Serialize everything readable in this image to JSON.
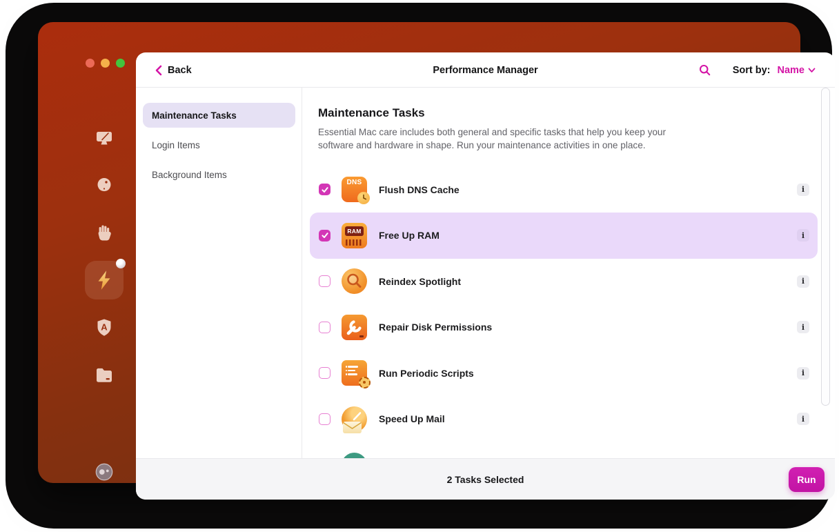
{
  "header": {
    "back_label": "Back",
    "title": "Performance Manager",
    "sort_by_label": "Sort by:",
    "sort_value": "Name"
  },
  "window": {
    "controls": [
      "close",
      "minimize",
      "zoom"
    ],
    "sidebar_icons": [
      "cleanup-icon",
      "ball-icon",
      "hand-icon",
      "lightning-icon",
      "applications-shield-icon",
      "folder-icon",
      "assistant-icon"
    ],
    "active_sidebar_icon": "lightning-icon",
    "active_has_notification_dot": true
  },
  "nav": {
    "items": [
      {
        "label": "Maintenance Tasks",
        "selected": true
      },
      {
        "label": "Login Items",
        "selected": false
      },
      {
        "label": "Background Items",
        "selected": false
      }
    ]
  },
  "content": {
    "heading": "Maintenance Tasks",
    "description": "Essential Mac care includes both general and specific tasks that help you keep your software and hardware in shape. Run your maintenance activities in one place.",
    "tasks": [
      {
        "label": "Flush DNS Cache",
        "checked": true,
        "highlighted": false,
        "icon": "dns-cache-icon"
      },
      {
        "label": "Free Up RAM",
        "checked": true,
        "highlighted": true,
        "icon": "ram-icon"
      },
      {
        "label": "Reindex Spotlight",
        "checked": false,
        "highlighted": false,
        "icon": "spotlight-icon"
      },
      {
        "label": "Repair Disk Permissions",
        "checked": false,
        "highlighted": false,
        "icon": "disk-permissions-icon"
      },
      {
        "label": "Run Periodic Scripts",
        "checked": false,
        "highlighted": false,
        "icon": "periodic-scripts-icon"
      },
      {
        "label": "Speed Up Mail",
        "checked": false,
        "highlighted": false,
        "icon": "mail-speed-icon"
      }
    ],
    "info_button_glyph": "i",
    "partial_next_task_visible": true
  },
  "icon_text": {
    "dns": "DNS",
    "ram": "RAM",
    "applications_letter": "A"
  },
  "footer": {
    "status": "2 Tasks Selected",
    "run_label": "Run"
  },
  "colors": {
    "accent_magenta": "#d415a6",
    "checkbox_checked": "#d336b6",
    "row_highlight": "#ead9fa",
    "nav_selected": "#e6e1f4",
    "window_gradient_top": "#ab2d0d",
    "window_gradient_bottom": "#6e2f15",
    "footer_bg": "#f5f5f7",
    "run_button": "#c716a8",
    "traffic_red": "#ec6a57",
    "traffic_yellow": "#f5b04a",
    "traffic_green": "#43c53d"
  }
}
